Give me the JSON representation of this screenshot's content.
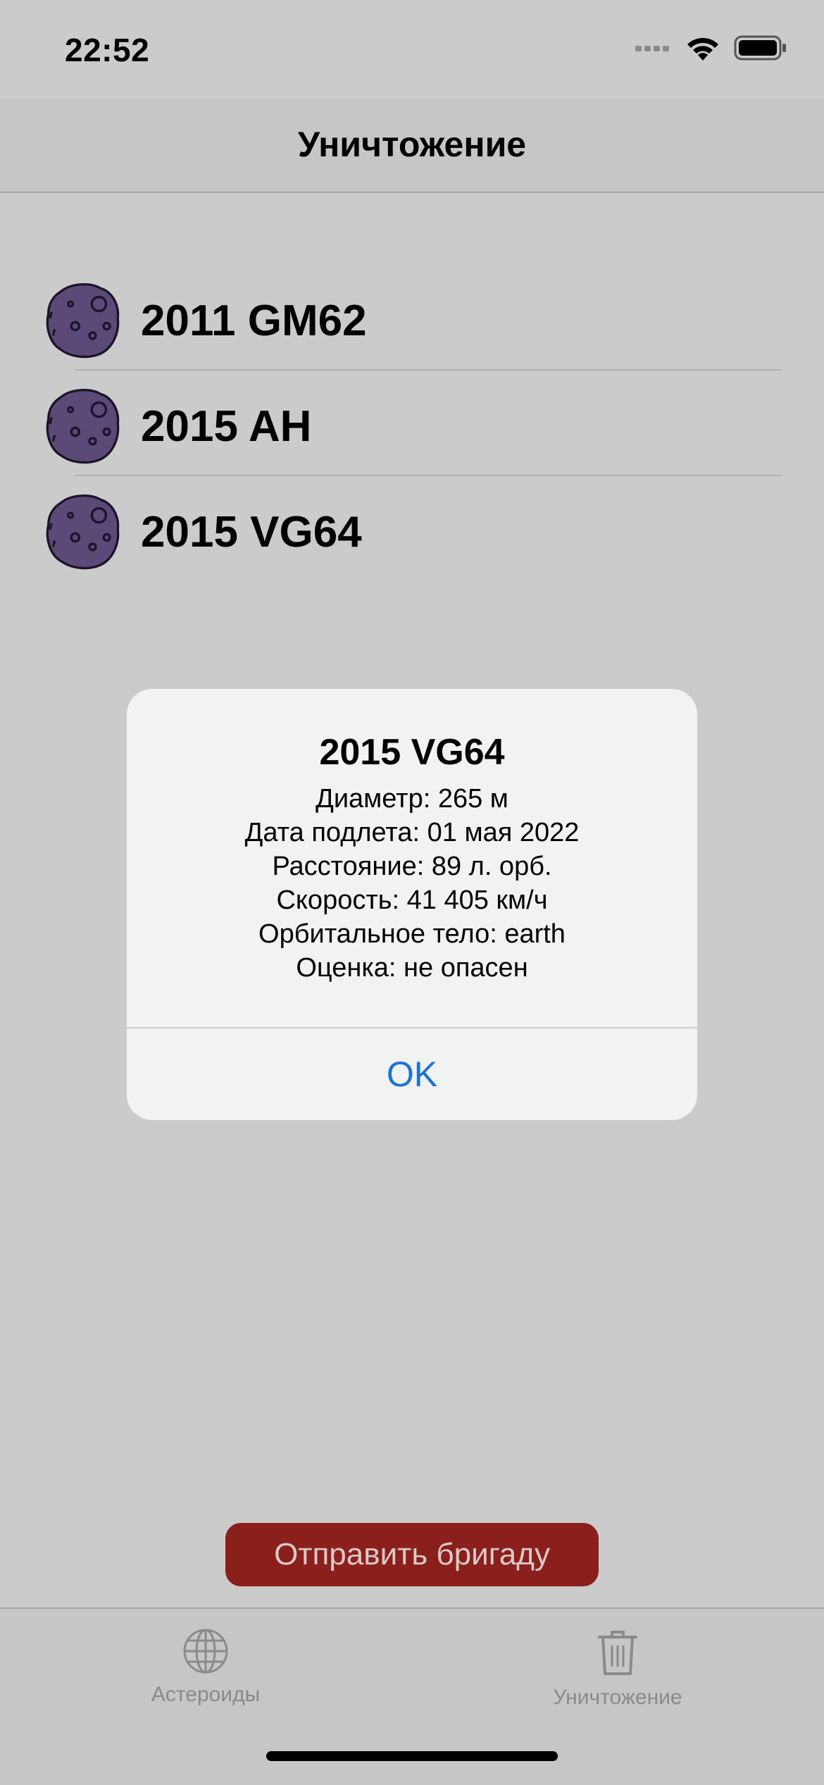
{
  "status_bar": {
    "time": "22:52"
  },
  "nav": {
    "title": "Уничтожение"
  },
  "asteroids": [
    {
      "name": "2011 GM62"
    },
    {
      "name": "2015 AH"
    },
    {
      "name": "2015 VG64"
    }
  ],
  "alert": {
    "title": "2015 VG64",
    "lines": [
      "Диаметр: 265 м",
      "Дата подлета: 01 мая 2022",
      "Расстояние: 89 л. орб.",
      "Скорость: 41 405 км/ч",
      "Орбитальное тело: earth",
      "Оценка: не опасен"
    ],
    "ok_label": "OK"
  },
  "send_button": {
    "label": "Отправить бригаду",
    "color": "#8a1f1c"
  },
  "tab_bar": {
    "tabs": [
      {
        "label": "Астероиды",
        "icon": "globe-icon"
      },
      {
        "label": "Уничтожение",
        "icon": "trash-icon"
      }
    ]
  },
  "colors": {
    "asteroid": "#5b4a78",
    "accent": "#1a73d9"
  }
}
